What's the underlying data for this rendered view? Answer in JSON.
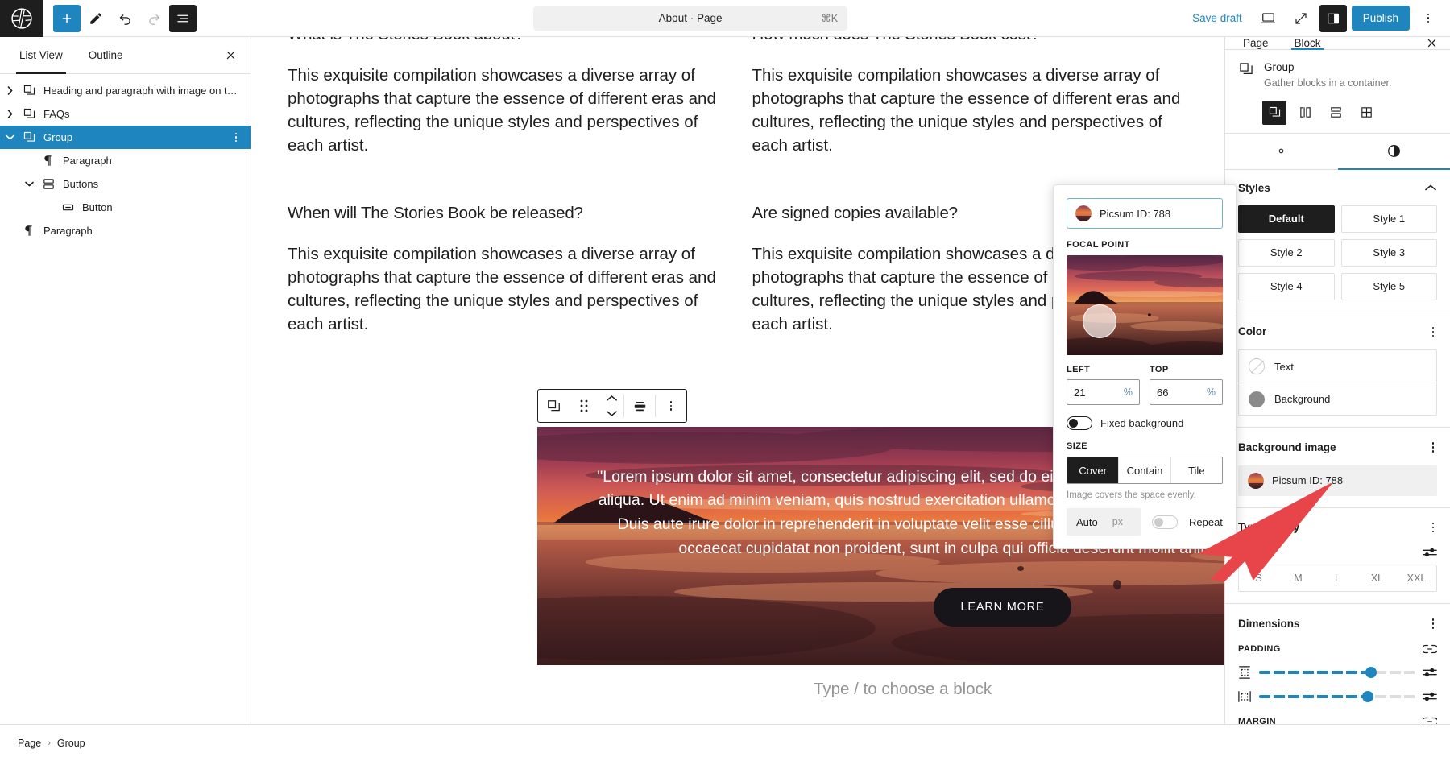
{
  "topbar": {
    "logo_icon": "wordpress-logo-icon",
    "buttons": [
      {
        "name": "add-block-button",
        "icon": "plus-icon",
        "label": "Add block"
      },
      {
        "name": "tools-button",
        "icon": "pencil-icon",
        "label": "Tools"
      },
      {
        "name": "undo-button",
        "icon": "undo-arrow-icon",
        "label": "Undo"
      },
      {
        "name": "redo-button",
        "icon": "redo-arrow-icon",
        "label": "Redo"
      },
      {
        "name": "list-view-button",
        "icon": "list-view-icon",
        "label": "Document Overview"
      }
    ],
    "command_bar": {
      "title": "About · Page",
      "shortcut": "⌘K"
    },
    "save_draft_label": "Save draft",
    "view_icon": "desktop-icon",
    "fullscreen_icon": "expand-icon",
    "settings_icon": "sidebar-panel-icon",
    "publish_label": "Publish",
    "options_icon": "vertical-dots-icon"
  },
  "listview": {
    "tabs": [
      {
        "label": "List View",
        "active": true
      },
      {
        "label": "Outline",
        "active": false
      }
    ],
    "close_icon": "close-icon",
    "items": [
      {
        "label": "Heading and paragraph with image on t…",
        "icon": "group-block-icon",
        "depth": 0,
        "chevron": "right",
        "selected": false
      },
      {
        "label": "FAQs",
        "icon": "group-block-icon",
        "depth": 0,
        "chevron": "right",
        "selected": false
      },
      {
        "label": "Group",
        "icon": "group-block-icon",
        "depth": 0,
        "chevron": "down",
        "selected": true
      },
      {
        "label": "Paragraph",
        "icon": "paragraph-block-icon",
        "depth": 1,
        "chevron": "none",
        "selected": false
      },
      {
        "label": "Buttons",
        "icon": "buttons-block-icon",
        "depth": 1,
        "chevron": "down",
        "selected": false
      },
      {
        "label": "Button",
        "icon": "button-block-icon",
        "depth": 2,
        "chevron": "none",
        "selected": false
      },
      {
        "label": "Paragraph",
        "icon": "paragraph-block-icon",
        "depth": 0,
        "chevron": "none",
        "selected": false
      }
    ]
  },
  "canvas": {
    "faqs": [
      {
        "heading": "What is The Stories Book about?",
        "body": "This exquisite compilation showcases a diverse array of photographs that capture the essence of different eras and cultures, reflecting the unique styles and perspectives of each artist."
      },
      {
        "heading": "How much does The Stories Book cost?",
        "body": "This exquisite compilation showcases a diverse array of photographs that capture the essence of different eras and cultures, reflecting the unique styles and perspectives of each artist."
      },
      {
        "heading": "When will The Stories Book be released?",
        "body": "This exquisite compilation showcases a diverse array of photographs that capture the essence of different eras and cultures, reflecting the unique styles and perspectives of each artist."
      },
      {
        "heading": "Are signed copies available?",
        "body": "This exquisite compilation showcases a diverse array of photographs that capture the essence of different eras and cultures, reflecting the unique styles and perspectives of each artist."
      }
    ],
    "block_toolbar": {
      "block_icon": "group-block-icon",
      "drag_icon": "drag-handle-icon",
      "move_up_icon": "chevron-up-icon",
      "move_down_icon": "chevron-down-icon",
      "align_icon": "align-center-icon",
      "options_icon": "vertical-dots-icon"
    },
    "cover": {
      "quote": "\"Lorem ipsum dolor sit amet, consectetur adipiscing elit, sed do eiusmod tempor incididunt ut labore et dolore magna aliqua. Ut enim ad minim veniam, quis nostrud exercitation ullamco laboris nisi ut aliquip ex ea commodo consequat. Duis aute irure dolor in reprehenderit in voluptate velit esse cillum dolore eu fugiat nulla pariatur. Excepteur sint occaecat cupidatat non proident, sunt in culpa qui officia deserunt mollit anim id est laborum.\"",
      "button_label": "LEARN MORE",
      "appender_icon": "plus-icon"
    },
    "type_prompt": "Type / to choose a block"
  },
  "popover": {
    "media_name": "Picsum ID: 788",
    "focal_point_label": "FOCAL POINT",
    "focal_left_label": "LEFT",
    "focal_top_label": "TOP",
    "focal_left_value": "21",
    "focal_top_value": "66",
    "unit": "%",
    "fixed_background_label": "Fixed background",
    "fixed_background_on": true,
    "size_label": "SIZE",
    "size_options": [
      "Cover",
      "Contain",
      "Tile"
    ],
    "size_selected": "Cover",
    "size_help": "Image covers the space evenly.",
    "auto_value": "Auto",
    "auto_unit": "px",
    "repeat_label": "Repeat",
    "repeat_on": false
  },
  "inspector": {
    "tabs": [
      {
        "label": "Page",
        "active": false
      },
      {
        "label": "Block",
        "active": true
      }
    ],
    "close_icon": "close-icon",
    "block": {
      "icon": "group-block-icon",
      "title": "Group",
      "description": "Gather blocks in a container.",
      "layout_options": [
        {
          "name": "group-variation",
          "icon": "group-icon",
          "active": true
        },
        {
          "name": "row-variation",
          "icon": "row-icon",
          "active": false
        },
        {
          "name": "stack-variation",
          "icon": "stack-icon",
          "active": false
        },
        {
          "name": "grid-variation",
          "icon": "grid-icon",
          "active": false
        }
      ]
    },
    "subtabs": [
      {
        "name": "settings-tab",
        "icon": "gear-icon",
        "active": false
      },
      {
        "name": "styles-tab",
        "icon": "contrast-half-circle-icon",
        "active": true
      }
    ],
    "styles": {
      "title": "Styles",
      "collapse_icon": "chevron-up-icon",
      "options": [
        "Default",
        "Style 1",
        "Style 2",
        "Style 3",
        "Style 4",
        "Style 5"
      ],
      "selected": "Default"
    },
    "color": {
      "title": "Color",
      "options_icon": "vertical-dots-icon",
      "rows": [
        {
          "label": "Text",
          "swatch": "none"
        },
        {
          "label": "Background",
          "swatch": "#8a8a8a"
        }
      ]
    },
    "background_image": {
      "title": "Background image",
      "options_icon": "vertical-dots-icon",
      "value": "Picsum ID: 788"
    },
    "typography": {
      "title": "Typography",
      "options_icon": "vertical-dots-icon",
      "size_label": "SIZE",
      "size_settings_icon": "sliders-icon",
      "size_options": [
        "S",
        "M",
        "L",
        "XL",
        "XXL"
      ],
      "size_selected": ""
    },
    "dimensions": {
      "title": "Dimensions",
      "options_icon": "vertical-dots-icon",
      "padding_label": "PADDING",
      "link_icon": "link-sides-icon",
      "padding_vertical": {
        "icon": "padding-vertical-icon",
        "percent": 72,
        "settings_icon": "sliders-icon"
      },
      "padding_horizontal": {
        "icon": "padding-horizontal-icon",
        "percent": 70,
        "settings_icon": "sliders-icon"
      },
      "margin_label": "MARGIN",
      "margin_link_icon": "link-sides-icon"
    }
  },
  "footer": {
    "breadcrumbs": [
      "Page",
      "Group"
    ],
    "separator": "›"
  },
  "colors": {
    "accent": "#1e85be",
    "dark": "#1e1e1e",
    "border": "#e0e0e0",
    "muted": "#757575",
    "annotation": "#e8454a"
  }
}
